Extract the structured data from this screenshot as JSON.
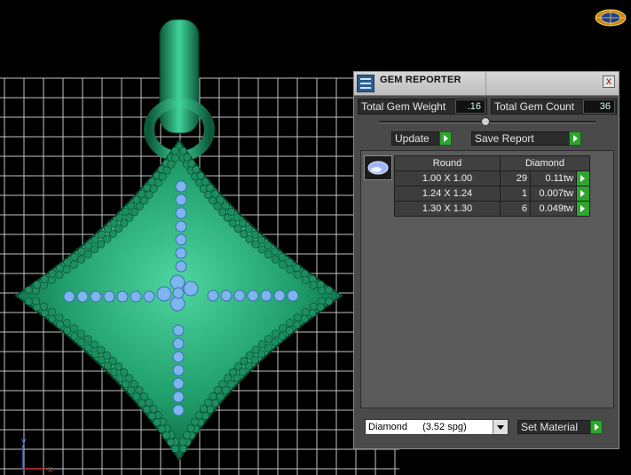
{
  "panel": {
    "title": "GEM REPORTER",
    "close_symbol": "x",
    "total_gem_weight_label": "Total Gem Weight",
    "total_gem_weight_value": ".16",
    "total_gem_count_label": "Total Gem Count",
    "total_gem_count_value": "36",
    "update_label": "Update",
    "save_report_label": "Save Report",
    "table": {
      "headers": [
        "Round",
        "Diamond"
      ],
      "rows": [
        {
          "size": "1.00 X 1.00",
          "count": "29",
          "weight": "0.11tw"
        },
        {
          "size": "1.24 X 1.24",
          "count": "1",
          "weight": "0.007tw"
        },
        {
          "size": "1.30 X 1.30",
          "count": "6",
          "weight": "0.049tw"
        }
      ]
    },
    "material_select": {
      "name": "Diamond",
      "spg": "(3.52 spg)"
    },
    "set_material_label": "Set Material"
  },
  "viewport": {
    "axis_y_label": "y",
    "axis_x_label": "x"
  },
  "colors": {
    "metal": "#1f9e6a",
    "gem": "#7fb5ee",
    "grid": "#d8d8d8",
    "accent_go": "#2ea52e"
  },
  "icons": {
    "logo": "globe-logo-icon",
    "panel": "report-icon",
    "gem": "oval-gem-icon",
    "close": "close-icon"
  }
}
